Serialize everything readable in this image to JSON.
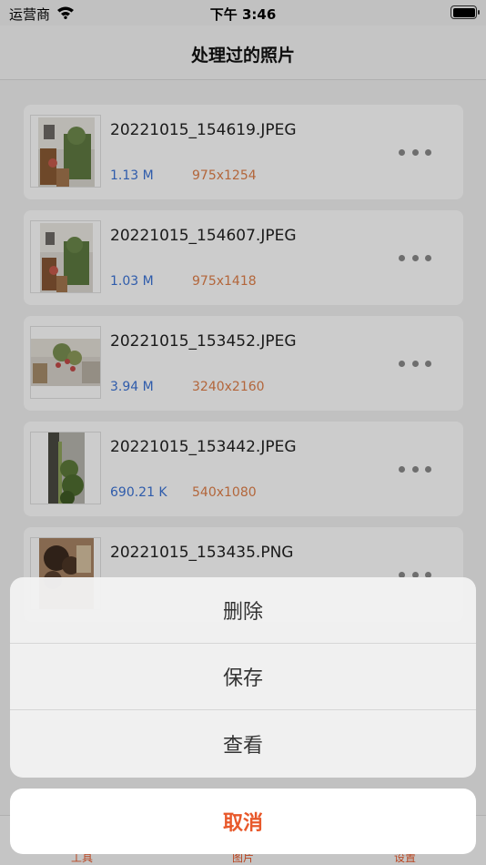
{
  "status_bar": {
    "carrier": "运营商",
    "time": "下午 3:46",
    "battery_level": 1.0
  },
  "nav": {
    "title": "处理过的照片"
  },
  "photos": [
    {
      "name": "20221015_154619.JPEG",
      "size": "1.13 M",
      "dimensions": "975x1254"
    },
    {
      "name": "20221015_154607.JPEG",
      "size": "1.03 M",
      "dimensions": "975x1418"
    },
    {
      "name": "20221015_153452.JPEG",
      "size": "3.94 M",
      "dimensions": "3240x2160"
    },
    {
      "name": "20221015_153442.JPEG",
      "size": "690.21 K",
      "dimensions": "540x1080"
    },
    {
      "name": "20221015_153435.PNG",
      "size": "",
      "dimensions": ""
    }
  ],
  "tab_bar": {
    "tabs": [
      {
        "label": "工具"
      },
      {
        "label": "图片"
      },
      {
        "label": "设置"
      }
    ]
  },
  "action_sheet": {
    "items": [
      {
        "label": "删除"
      },
      {
        "label": "保存"
      },
      {
        "label": "查看"
      }
    ],
    "cancel_label": "取消"
  },
  "colors": {
    "accent": "#e8582a",
    "size_text": "#3b73d6",
    "dimension_text": "#e0804a"
  },
  "icons": [
    "wifi-icon",
    "battery-icon",
    "more-icon"
  ]
}
